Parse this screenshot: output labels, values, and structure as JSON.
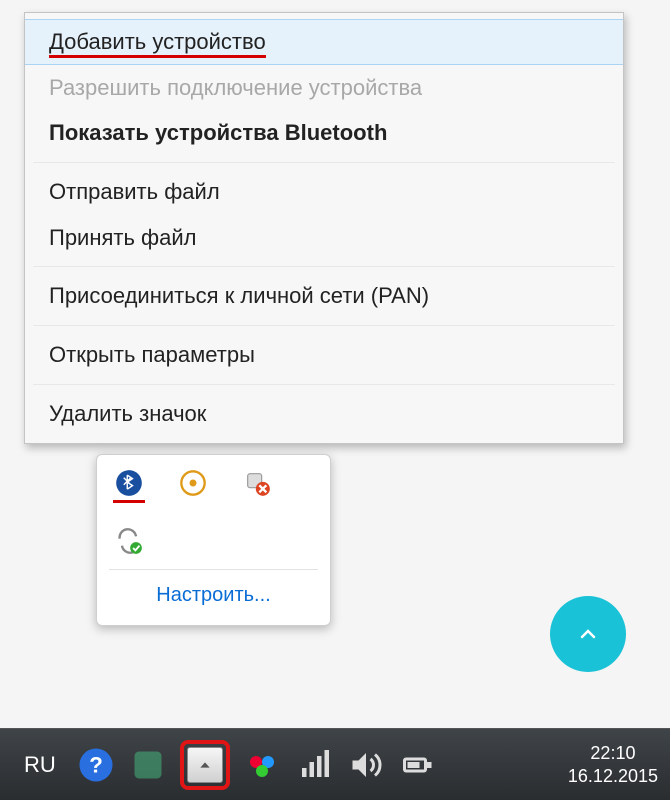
{
  "context_menu": {
    "items": [
      {
        "label": "Добавить устройство",
        "state": "hovered",
        "redmark": true
      },
      {
        "label": "Разрешить подключение устройства",
        "state": "disabled"
      },
      {
        "label": "Показать устройства Bluetooth",
        "state": "bold"
      },
      "---",
      {
        "label": "Отправить файл"
      },
      {
        "label": "Принять файл"
      },
      "---",
      {
        "label": "Присоединиться к личной сети (PAN)"
      },
      "---",
      {
        "label": "Открыть параметры"
      },
      "---",
      {
        "label": "Удалить значок"
      }
    ]
  },
  "tray_flyout": {
    "icons": [
      {
        "name": "bluetooth-icon",
        "redmark": true
      },
      {
        "name": "safely-remove-icon"
      },
      {
        "name": "blocked-icon"
      },
      {
        "name": "sync-ok-icon"
      }
    ],
    "settings_link": "Настроить..."
  },
  "taskbar": {
    "language": "RU",
    "clock_time": "22:10",
    "clock_date": "16.12.2015",
    "icons": [
      {
        "name": "help-icon"
      },
      {
        "name": "app-icon"
      }
    ],
    "tray_icons_right": [
      {
        "name": "people-icon"
      },
      {
        "name": "network-icon"
      },
      {
        "name": "volume-icon"
      },
      {
        "name": "power-icon"
      }
    ]
  }
}
